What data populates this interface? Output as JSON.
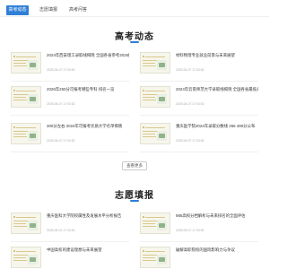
{
  "nav": {
    "tabs": [
      {
        "label": "高考动态",
        "active": true
      },
      {
        "label": "志愿填报",
        "active": false
      },
      {
        "label": "高考问答",
        "active": false
      }
    ]
  },
  "news_section": {
    "title": "高考动态",
    "items": [
      {
        "title": "2024年西安理工录取线揭晓 全国各省参考2026招生",
        "date": "2025-06-07 17:03:52"
      },
      {
        "title": "材料物理专业就业前景与未来展望",
        "date": "2025-06-07 17:03:52"
      },
      {
        "title": "2026年250分可报考哪些专科 排名一览",
        "date": "2025-06-07 17:03:52"
      },
      {
        "title": "2024年云南师范大学录取线揭晓 全国各省最低分一览",
        "date": "2025-06-07 17:03:52"
      },
      {
        "title": "300分左右 2024年可报考优质大学名单揭晓",
        "date": "2025-06-07 17:03:52"
      },
      {
        "title": "重庆医学院2024年录取分数线 266 490分公布",
        "date": "2025-06-07 17:03:52"
      }
    ],
    "more_label": "查看更多"
  },
  "fill_section": {
    "title": "志愿填报",
    "items": [
      {
        "title": "重庆医科大学院校属性及发展水平分析报告",
        "date": "2025-05-01 17:03:52"
      },
      {
        "title": "985高校分档解析与未来排名的全面评估",
        "date": "2025-05-07 17:03:52"
      },
      {
        "title": "中国高校的建设理想与未来展望",
        "date": ""
      },
      {
        "title": "破解高职院校的国际影响力与争议",
        "date": ""
      }
    ]
  },
  "colors": {
    "accent": "#2f7fd6"
  }
}
